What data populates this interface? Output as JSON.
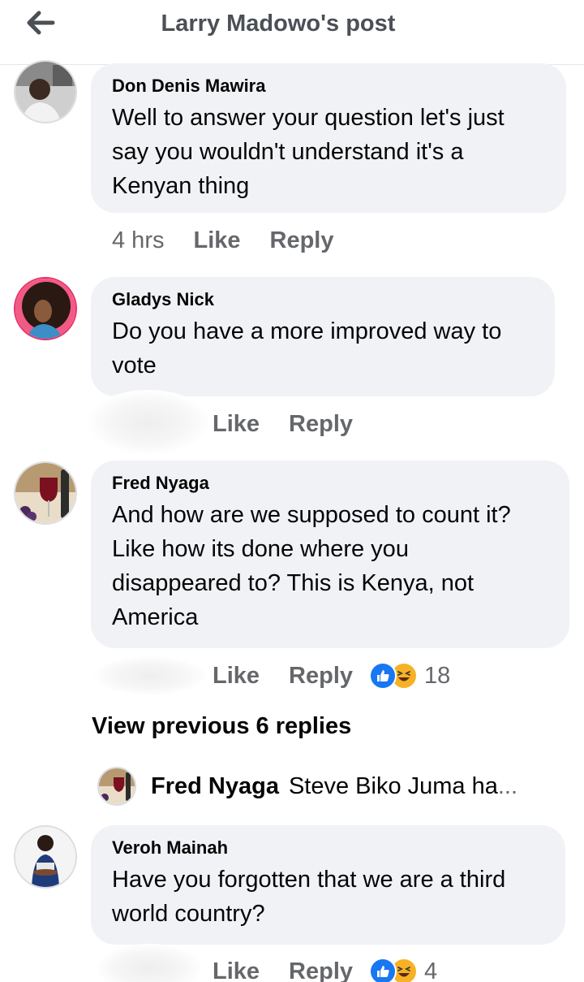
{
  "header": {
    "title": "Larry Madowo's post",
    "back_icon": "arrow-left-icon"
  },
  "comments": [
    {
      "author": "Don Denis Mawira",
      "lines": [
        "Well to answer your question let's just",
        "say you wouldn't understand it's a",
        "Kenyan thing"
      ],
      "time": "4 hrs",
      "like": "Like",
      "reply": "Reply"
    },
    {
      "author": "Gladys Nick",
      "lines": [
        "Do you have a more improved way to",
        "vote"
      ],
      "time": "",
      "like": "Like",
      "reply": "Reply"
    },
    {
      "author": "Fred Nyaga",
      "lines": [
        "And how are we supposed to count it?",
        "Like how its done where you",
        "disappeared to? This is Kenya, not",
        "America"
      ],
      "time": "",
      "like": "Like",
      "reply": "Reply",
      "reaction_count": "18"
    },
    {
      "author": "Veroh Mainah",
      "lines": [
        "Have you forgotten that we are a third",
        "world country?"
      ],
      "time": "",
      "like": "Like",
      "reply": "Reply",
      "reaction_count": "4"
    }
  ],
  "view_previous": "View previous 6 replies",
  "reply_preview": {
    "author": "Fred Nyaga",
    "text": "Steve Biko Juma  ha",
    "ellipsis": "..."
  },
  "colors": {
    "bubble": "#f0f2f5",
    "secondary_text": "#65676b",
    "like_blue": "#1877f2",
    "haha_yellow": "#f7b125"
  }
}
